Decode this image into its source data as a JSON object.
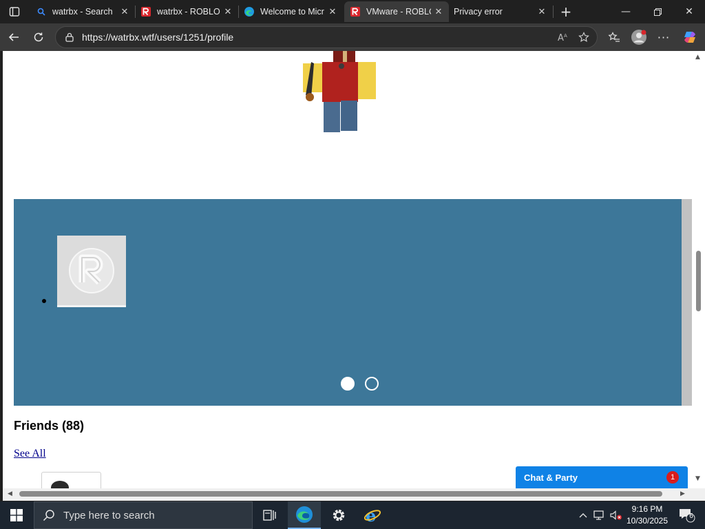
{
  "tabs": [
    {
      "title": "watrbx - Search",
      "icon": "search-icon",
      "active": false
    },
    {
      "title": "watrbx - ROBLOX",
      "icon": "roblox-logo-icon",
      "active": false
    },
    {
      "title": "Welcome to Micr",
      "icon": "edge-logo-icon",
      "active": false
    },
    {
      "title": "VMware - ROBLO",
      "icon": "roblox-logo-icon",
      "active": true
    },
    {
      "title": "Privacy error",
      "icon": "",
      "active": false
    }
  ],
  "address_bar": {
    "url": "https://watrbx.wtf/users/1251/profile"
  },
  "profile": {
    "friends_heading": "Friends (88)",
    "see_all_label": "See All",
    "carousel_pages": 2,
    "carousel_active_page": 1
  },
  "chat": {
    "label": "Chat & Party",
    "badge_count": "1"
  },
  "taskbar": {
    "search_placeholder": "Type here to search",
    "clock_time": "9:16 PM",
    "clock_date": "10/30/2025",
    "notification_count": "6"
  },
  "colors": {
    "banner": "#3d7799",
    "chat_bar": "#0f82e6",
    "badge": "#d91c1c",
    "link": "#00008b"
  }
}
